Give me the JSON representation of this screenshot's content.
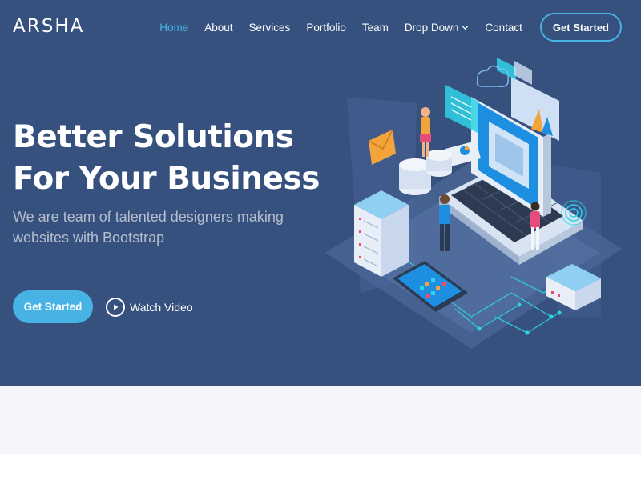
{
  "header": {
    "logo": "ARSHA",
    "nav": [
      {
        "label": "Home",
        "active": true
      },
      {
        "label": "About"
      },
      {
        "label": "Services"
      },
      {
        "label": "Portfolio"
      },
      {
        "label": "Team"
      },
      {
        "label": "Drop Down",
        "icon": "chevron-down-icon"
      },
      {
        "label": "Contact"
      }
    ],
    "cta": "Get Started"
  },
  "hero": {
    "title": "Better Solutions For Your Business",
    "subtitle": "We are team of talented designers making websites with Bootstrap",
    "primary_button": "Get Started",
    "video_button": "Watch Video",
    "video_icon": "play-icon"
  },
  "colors": {
    "hero_bg": "#37517e",
    "accent": "#47b2e4",
    "section_bg": "#f3f5fa"
  }
}
